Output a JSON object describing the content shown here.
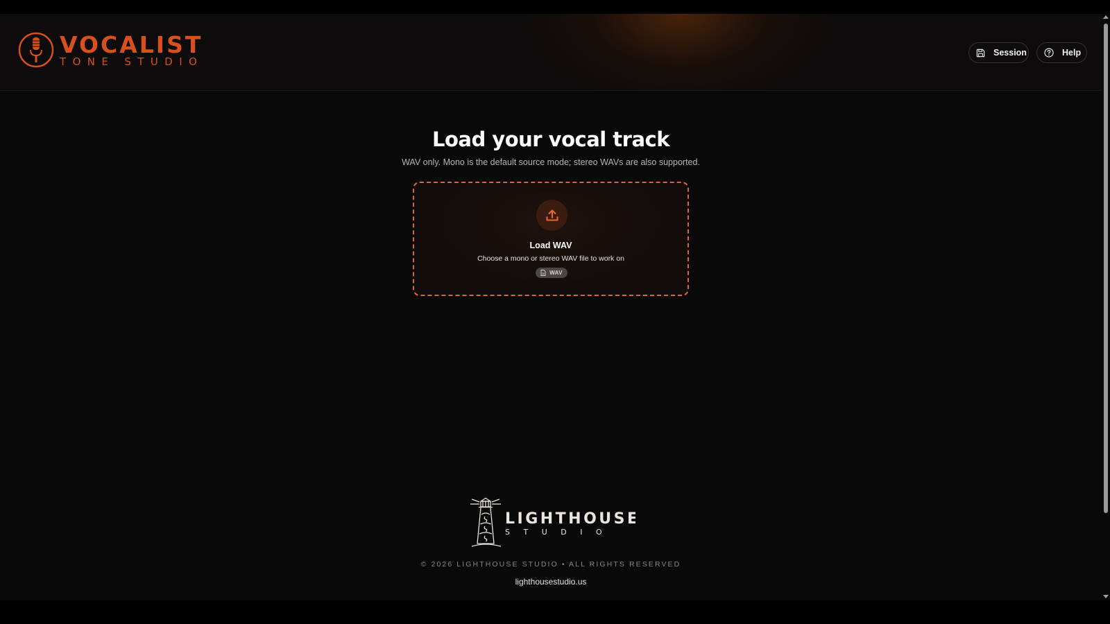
{
  "app": {
    "brand_word": "VOCALIST",
    "brand_sub": "TONE STUDIO",
    "brand_color": "#d9501c"
  },
  "header": {
    "buttons": [
      {
        "label": "Session",
        "icon": "save-icon"
      },
      {
        "label": "Help",
        "icon": "help-circle-icon"
      }
    ]
  },
  "main": {
    "title": "Load your vocal track",
    "subtitle": "WAV only. Mono is the default source mode; stereo WAVs are also supported.",
    "dropzone": {
      "icon": "upload-icon",
      "title": "Load WAV",
      "description": "Choose a mono or stereo WAV file to work on",
      "chip_icon": "file-icon",
      "chip_label": "WAV",
      "border_color": "#e0623a"
    }
  },
  "footer": {
    "logo_word": "LIGHTHOUSE",
    "logo_sub": "S T U D I O",
    "copyright": "© 2026 LIGHTHOUSE STUDIO • ALL RIGHTS RESERVED",
    "link": "lighthousestudio.us"
  }
}
